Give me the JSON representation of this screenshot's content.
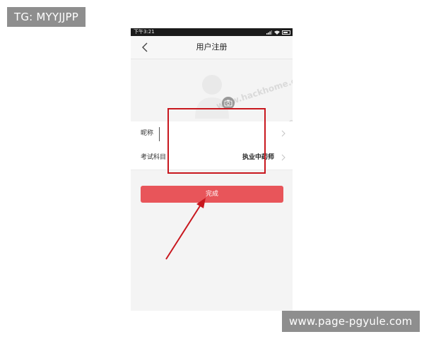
{
  "overlays": {
    "top_left_tag": "TG: MYYJJPP",
    "bottom_right_tag": "www.page-pgyule.com"
  },
  "phone": {
    "status_bar": {
      "time": "下午3:21",
      "icons": [
        "signal-icon",
        "wifi-icon",
        "battery-icon"
      ]
    },
    "nav": {
      "title": "用户注册",
      "back_icon": "back-chevron-icon"
    },
    "watermark_text": "www.hackhome.com",
    "form": {
      "nickname_label": "昵称",
      "nickname_placeholder": "",
      "subject_label": "考试科目",
      "subject_value": "执业中药师"
    },
    "submit_label": "完成"
  },
  "colors": {
    "primary_button": "#e8555a",
    "annotation_red": "#c8171e",
    "tag_gray": "#8e8e8e"
  }
}
